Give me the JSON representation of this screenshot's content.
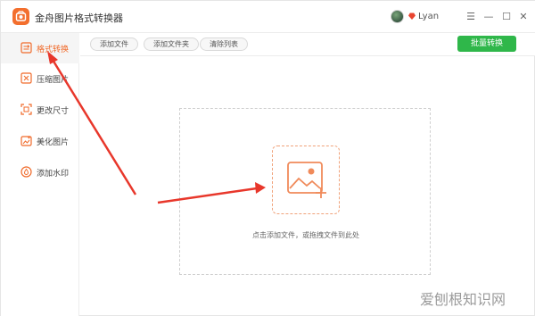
{
  "app": {
    "title": "金舟图片格式转换器",
    "username": "Lyan",
    "window_controls": [
      "☰",
      "—",
      "☐",
      "✕"
    ]
  },
  "sidebar": {
    "items": [
      {
        "label": "格式转换",
        "icon": "format-convert-icon",
        "active": true
      },
      {
        "label": "压缩图片",
        "icon": "compress-icon",
        "active": false
      },
      {
        "label": "更改尺寸",
        "icon": "resize-icon",
        "active": false
      },
      {
        "label": "美化图片",
        "icon": "beautify-icon",
        "active": false
      },
      {
        "label": "添加水印",
        "icon": "watermark-icon",
        "active": false
      }
    ]
  },
  "toolbar": {
    "add_file": "添加文件",
    "add_folder": "添加文件夹",
    "clear_list": "清除列表",
    "batch_convert": "批量转换"
  },
  "dropzone": {
    "hint": "点击添加文件，或拖拽文件到此处"
  },
  "watermark": {
    "text": "爱刨根知识网"
  },
  "colors": {
    "accent": "#f06a2a",
    "batch_button": "#2fb74a",
    "arrow": "#e8372b"
  }
}
